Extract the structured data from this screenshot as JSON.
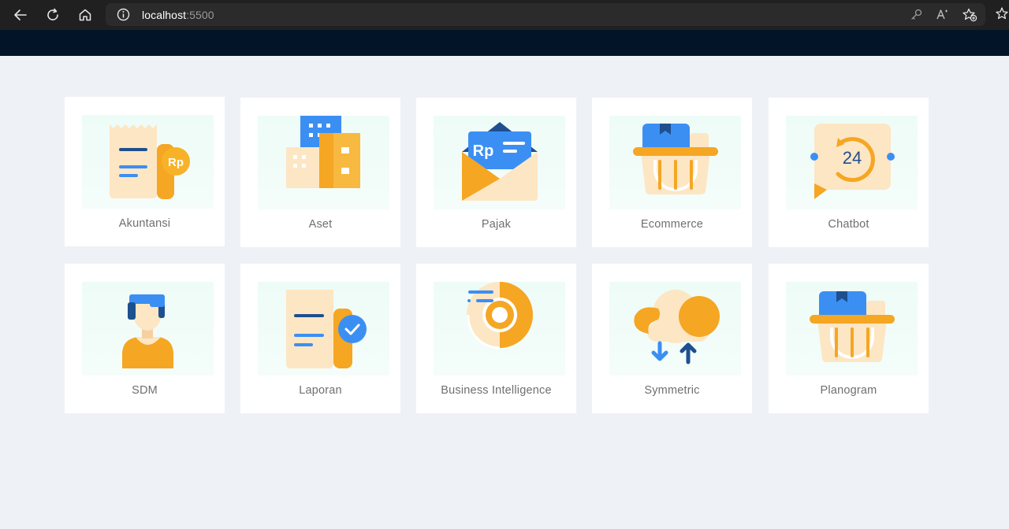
{
  "browser": {
    "url_host": "localhost",
    "url_port": ":5500"
  },
  "apps": [
    {
      "label": "Akuntansi",
      "icon": "accounting-receipt-icon"
    },
    {
      "label": "Aset",
      "icon": "buildings-icon"
    },
    {
      "label": "Pajak",
      "icon": "tax-envelope-icon"
    },
    {
      "label": "Ecommerce",
      "icon": "shopping-basket-icon"
    },
    {
      "label": "Chatbot",
      "icon": "chat-24-icon"
    },
    {
      "label": "SDM",
      "icon": "person-icon"
    },
    {
      "label": "Laporan",
      "icon": "report-check-icon"
    },
    {
      "label": "Business Intelligence",
      "icon": "donut-chart-icon"
    },
    {
      "label": "Symmetric",
      "icon": "cloud-sync-icon"
    },
    {
      "label": "Planogram",
      "icon": "shopping-basket-icon"
    }
  ],
  "colors": {
    "header": "#011428",
    "background": "#eef1f5",
    "blue": "#3b8ff3",
    "navy": "#1e4f8f",
    "orange": "#f5a623",
    "cream": "#fde6c3"
  }
}
